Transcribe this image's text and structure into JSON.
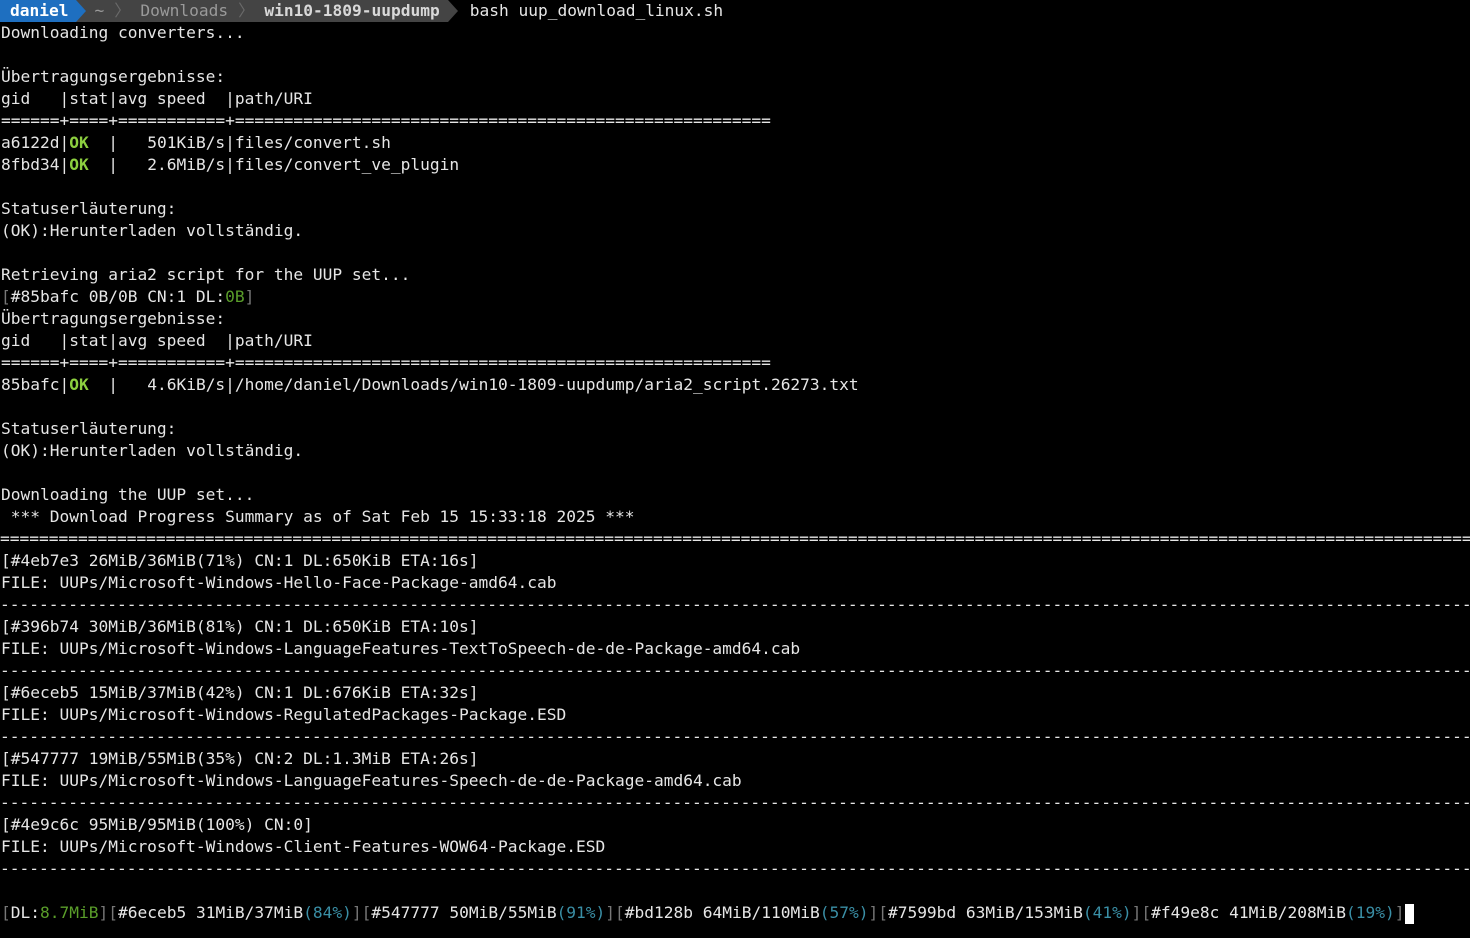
{
  "prompt": {
    "user": "daniel",
    "path": [
      "~",
      "Downloads",
      "win10-1809-uupdump"
    ],
    "command": "bash uup_download_linux.sh"
  },
  "colors": {
    "background": "#000000",
    "text": "#e6e6e6",
    "ok": "#8ccf3f",
    "prompt_user_bg": "#1e6fc0",
    "prompt_path_bg": "#444444",
    "percent": "#3a8fa6"
  },
  "section1": {
    "status": "Downloading converters...",
    "results_title": "Übertragungsergebnisse:",
    "header": "gid   |stat|avg speed  |path/URI",
    "rule": "======+====+===========+=======================================================",
    "rows": [
      {
        "gid": "a6122d",
        "stat": "OK",
        "speed": "|   501KiB/s|files/convert.sh"
      },
      {
        "gid": "8fbd34",
        "stat": "OK",
        "speed": "|   2.6MiB/s|files/convert_ve_plugin"
      }
    ],
    "legend_title": "Statuserläuterung:",
    "legend_text": "(OK):Herunterladen vollständig."
  },
  "section2": {
    "status": "Retrieving aria2 script for the UUP set...",
    "progress_id": "#85bafc 0B/0B CN:1 DL:",
    "progress_dl": "0B",
    "results_title": "Übertragungsergebnisse:",
    "header": "gid   |stat|avg speed  |path/URI",
    "rule": "======+====+===========+=======================================================",
    "rows": [
      {
        "gid": "85bafc",
        "stat": "OK",
        "speed": "|   4.6KiB/s|/home/daniel/Downloads/win10-1809-uupdump/aria2_script.26273.txt"
      }
    ],
    "legend_title": "Statuserläuterung:",
    "legend_text": "(OK):Herunterladen vollständig."
  },
  "section3": {
    "status": "Downloading the UUP set...",
    "summary": " *** Download Progress Summary as of Sat Feb 15 15:33:18 2025 ***",
    "double_rule": "=========================================================================================================================================================",
    "single_rule": "---------------------------------------------------------------------------------------------------------------------------------------------------------",
    "items": [
      {
        "progress": "[#4eb7e3 26MiB/36MiB(71%) CN:1 DL:650KiB ETA:16s]",
        "file": "FILE: UUPs/Microsoft-Windows-Hello-Face-Package-amd64.cab"
      },
      {
        "progress": "[#396b74 30MiB/36MiB(81%) CN:1 DL:650KiB ETA:10s]",
        "file": "FILE: UUPs/Microsoft-Windows-LanguageFeatures-TextToSpeech-de-de-Package-amd64.cab"
      },
      {
        "progress": "[#6eceb5 15MiB/37MiB(42%) CN:1 DL:676KiB ETA:32s]",
        "file": "FILE: UUPs/Microsoft-Windows-RegulatedPackages-Package.ESD"
      },
      {
        "progress": "[#547777 19MiB/55MiB(35%) CN:2 DL:1.3MiB ETA:26s]",
        "file": "FILE: UUPs/Microsoft-Windows-LanguageFeatures-Speech-de-de-Package-amd64.cab"
      },
      {
        "progress": "[#4e9c6c 95MiB/95MiB(100%) CN:0]",
        "file": "FILE: UUPs/Microsoft-Windows-Client-Features-WOW64-Package.ESD"
      }
    ]
  },
  "statusbar": {
    "dl_label": "DL:",
    "dl_value": "8.7MiB",
    "items": [
      {
        "id": "#6eceb5 31MiB/37MiB",
        "pct": "(84%)"
      },
      {
        "id": "#547777 50MiB/55MiB",
        "pct": "(91%)"
      },
      {
        "id": "#bd128b 64MiB/110MiB",
        "pct": "(57%)"
      },
      {
        "id": "#7599bd 63MiB/153MiB",
        "pct": "(41%)"
      },
      {
        "id": "#f49e8c 41MiB/208MiB",
        "pct": "(19%)"
      }
    ]
  }
}
